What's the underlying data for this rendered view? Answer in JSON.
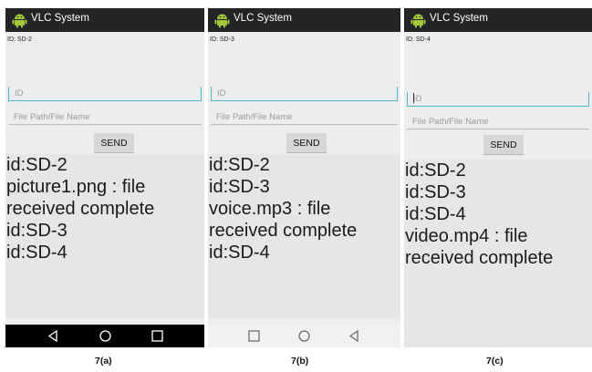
{
  "app_title": "VLC System",
  "id_placeholder": "ID",
  "path_placeholder": "File Path/File Name",
  "send_label": "SEND",
  "panels": [
    {
      "id_label": "ID: SD-2",
      "log": [
        "id:SD-2",
        "picture1.png : file",
        "received complete",
        "id:SD-3",
        "id:SD-4"
      ],
      "caption": "7(a)",
      "nav_icons": [
        "back-icon",
        "home-icon",
        "recents-icon"
      ]
    },
    {
      "id_label": "ID: SD-3",
      "log": [
        "id:SD-2",
        "id:SD-3",
        "voice.mp3 : file",
        "received complete",
        "id:SD-4"
      ],
      "caption": "7(b)",
      "nav_icons": [
        "recents-icon",
        "home-icon",
        "back-icon"
      ]
    },
    {
      "id_label": "ID: SD-4",
      "log": [
        "id:SD-2",
        "id:SD-3",
        "id:SD-4",
        "video.mp4 : file",
        "received complete"
      ],
      "caption": "7(c)",
      "nav_icons": []
    }
  ],
  "colors": {
    "title_bar": "#222426",
    "focus_line": "#4fb5d1",
    "log_bg": "#e6e6e6",
    "android_green": "#a4c639"
  }
}
